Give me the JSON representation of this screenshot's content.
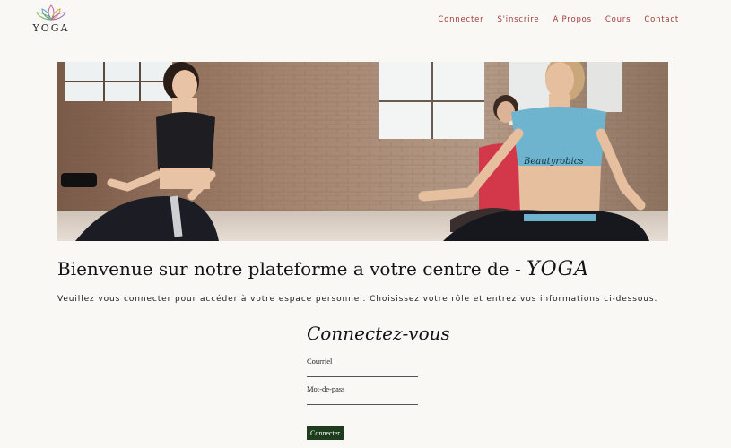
{
  "header": {
    "logo_text": "YOGA",
    "nav": [
      {
        "label": "Connecter"
      },
      {
        "label": "S'inscrire"
      },
      {
        "label": "A Propos"
      },
      {
        "label": "Cours"
      },
      {
        "label": "Contact"
      }
    ]
  },
  "hero": {
    "shirt_text": "Beautyrobics"
  },
  "welcome": {
    "text": "Bienvenue sur notre plateforme a votre centre de - ",
    "brand": "YOGA"
  },
  "intro": "Veuillez vous connecter pour accéder à votre espace personnel. Choisissez votre rôle et entrez vos informations ci-dessous.",
  "login": {
    "title": "Connectez-vous",
    "email_label": "Courriel",
    "email_value": "",
    "password_label": "Mot-de-pass",
    "password_value": "",
    "submit_label": "Connecter"
  },
  "colors": {
    "nav": "#a23a3a",
    "button": "#1d3d1d",
    "background": "#faf8f5"
  }
}
